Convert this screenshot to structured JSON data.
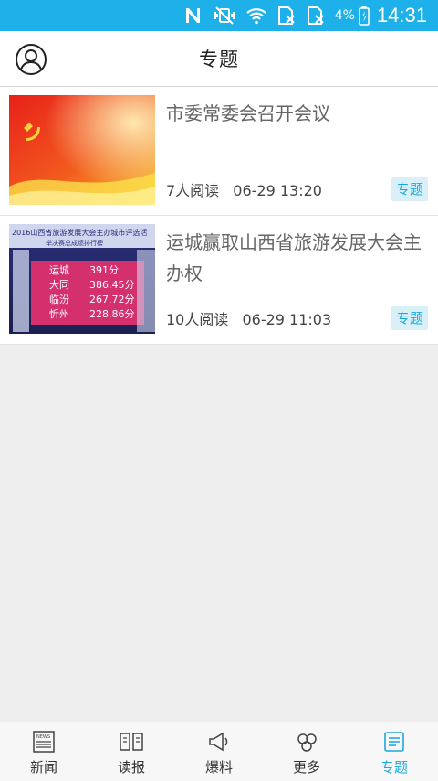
{
  "status": {
    "battery_percent": "4%",
    "time": "14:31",
    "icons": [
      "nfc-icon",
      "vibrate-mute-icon",
      "wifi-icon",
      "sim1-no-signal-icon",
      "sim2-no-signal-icon",
      "battery-charging-icon"
    ]
  },
  "header": {
    "title": "专题",
    "profile_icon": "user-circle-icon"
  },
  "articles": [
    {
      "title": "市委常委会召开会议",
      "reads": "7人阅读",
      "time": "06-29 13:20",
      "tag": "专题",
      "thumbnail": "red-flag-banner"
    },
    {
      "title": "运城赢取山西省旅游发展大会主办权",
      "reads": "10人阅读",
      "time": "06-29 11:03",
      "tag": "专题",
      "thumbnail": "ranking-screen",
      "thumbnail_text": {
        "header": "2016山西省旅游发展大会主办城市评选活",
        "subheader": "举决赛总成绩排行榜",
        "rows": [
          {
            "city": "运城",
            "score": "391分"
          },
          {
            "city": "大同",
            "score": "386.45分"
          },
          {
            "city": "临汾",
            "score": "267.72分"
          },
          {
            "city": "忻州",
            "score": "228.86分"
          }
        ]
      }
    }
  ],
  "nav": {
    "tabs": [
      {
        "label": "新闻",
        "icon": "newspaper-icon"
      },
      {
        "label": "读报",
        "icon": "open-paper-icon"
      },
      {
        "label": "爆料",
        "icon": "megaphone-icon"
      },
      {
        "label": "更多",
        "icon": "more-icon"
      },
      {
        "label": "专题",
        "icon": "topic-icon"
      }
    ],
    "active_index": 4
  },
  "colors": {
    "accent": "#1eb0e8",
    "tag_text": "#1aa8dc",
    "tag_bg": "#d9f0f8"
  }
}
